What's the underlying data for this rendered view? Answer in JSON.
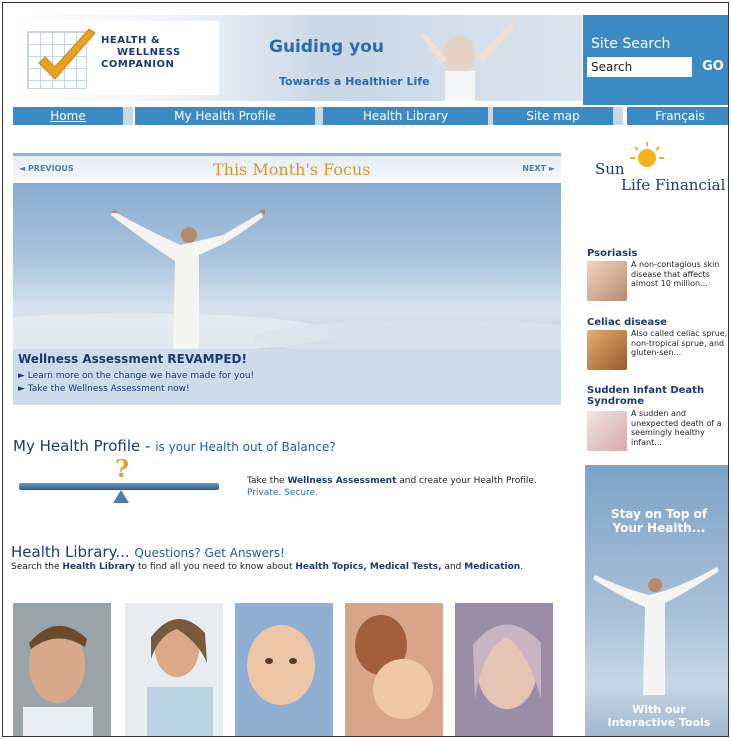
{
  "header": {
    "logo_line1": "HEALTH &",
    "logo_line2": "WELLNESS",
    "logo_line3": "COMPANION",
    "tagline_main": "Guiding you",
    "tagline_sub": "Towards a Healthier Life"
  },
  "search": {
    "title": "Site Search",
    "placeholder": "Search",
    "value": "Search",
    "go_label": "GO"
  },
  "nav": {
    "items": [
      {
        "label": "Home"
      },
      {
        "label": "My Health Profile"
      },
      {
        "label": "Health Library"
      },
      {
        "label": "Site map"
      },
      {
        "label": "Français"
      }
    ]
  },
  "focus": {
    "prev_label": "◄ PREVIOUS",
    "next_label": "NEXT ►",
    "title": "This Month's Focus",
    "caption_title": "Wellness Assessment REVAMPED!",
    "link1": "► Learn more on the change we have made for you!",
    "link2": "► Take the Wellness Assessment now!"
  },
  "health_profile": {
    "title": "My Health Profile",
    "dash": " - ",
    "subtitle": "is your Health out of Balance?",
    "text_pre": "Take the ",
    "text_bold": "Wellness Assessment",
    "text_mid": " and create your Health Profile. ",
    "text_private": "Private.",
    "text_secure": "Secure.",
    "scale_symbol": "?"
  },
  "health_library": {
    "title": "Health Library...",
    "subtitle": "Questions? Get Answers!",
    "text_pre": "Search the ",
    "text_link": "Health Library",
    "text_mid": " to find all you need to know about ",
    "text_topics": "Health Topics, Medical Tests,",
    "text_and": " and ",
    "text_med": "Medication",
    "text_end": "."
  },
  "sponsor": {
    "line1": "Sun",
    "line2": "Life Financial"
  },
  "side_items": [
    {
      "title": "Psoriasis",
      "desc": "A non-contagious skin disease that affects almost 10 million..."
    },
    {
      "title": "Celiac disease",
      "desc": "Also called celiac sprue, non-tropical sprue, and gluten-sen..."
    },
    {
      "title": "Sudden Infant Death Syndrome",
      "desc": "A sudden and unexpected death of a seemingly healthy infant..."
    }
  ],
  "promo": {
    "line1": "Stay on Top of",
    "line2": "Your Health...",
    "line3": "With our",
    "line4": "Interactive Tools"
  },
  "colors": {
    "nav_blue": "#3b8ac4",
    "navy": "#1f3a6e",
    "focus_orange": "#d9962a"
  }
}
